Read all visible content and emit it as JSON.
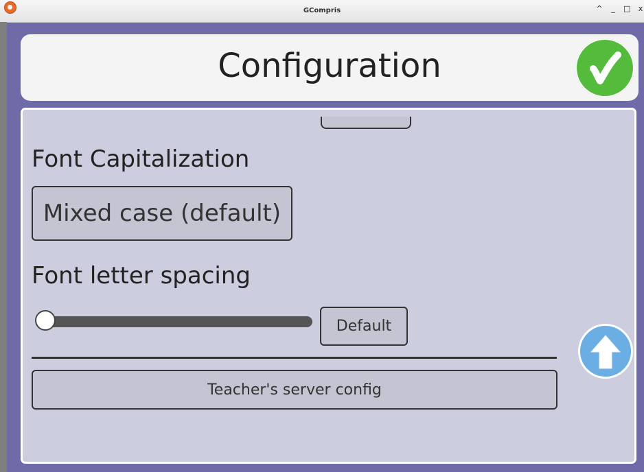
{
  "window": {
    "title": "GCompris",
    "buttons": [
      "^",
      "_",
      "□",
      "x"
    ]
  },
  "header": {
    "title": "Configuration"
  },
  "ok": {
    "icon": "check-icon",
    "color": "#55bb3d"
  },
  "settings": {
    "font_capitalization_label": "Font Capitalization",
    "font_capitalization_value": "Mixed case (default)",
    "font_letter_spacing_label": "Font letter spacing",
    "letter_spacing_level": 0,
    "default_label": "Default",
    "teacher_server_label": "Teacher's server config"
  },
  "scroll": {
    "icon": "arrow-up-icon"
  },
  "colors": {
    "background": "#6e6ba8",
    "panel": "#cccdde",
    "button": "#c4c4d2",
    "ok_green": "#55bb3d",
    "scroll_blue": "#6aaee4"
  }
}
